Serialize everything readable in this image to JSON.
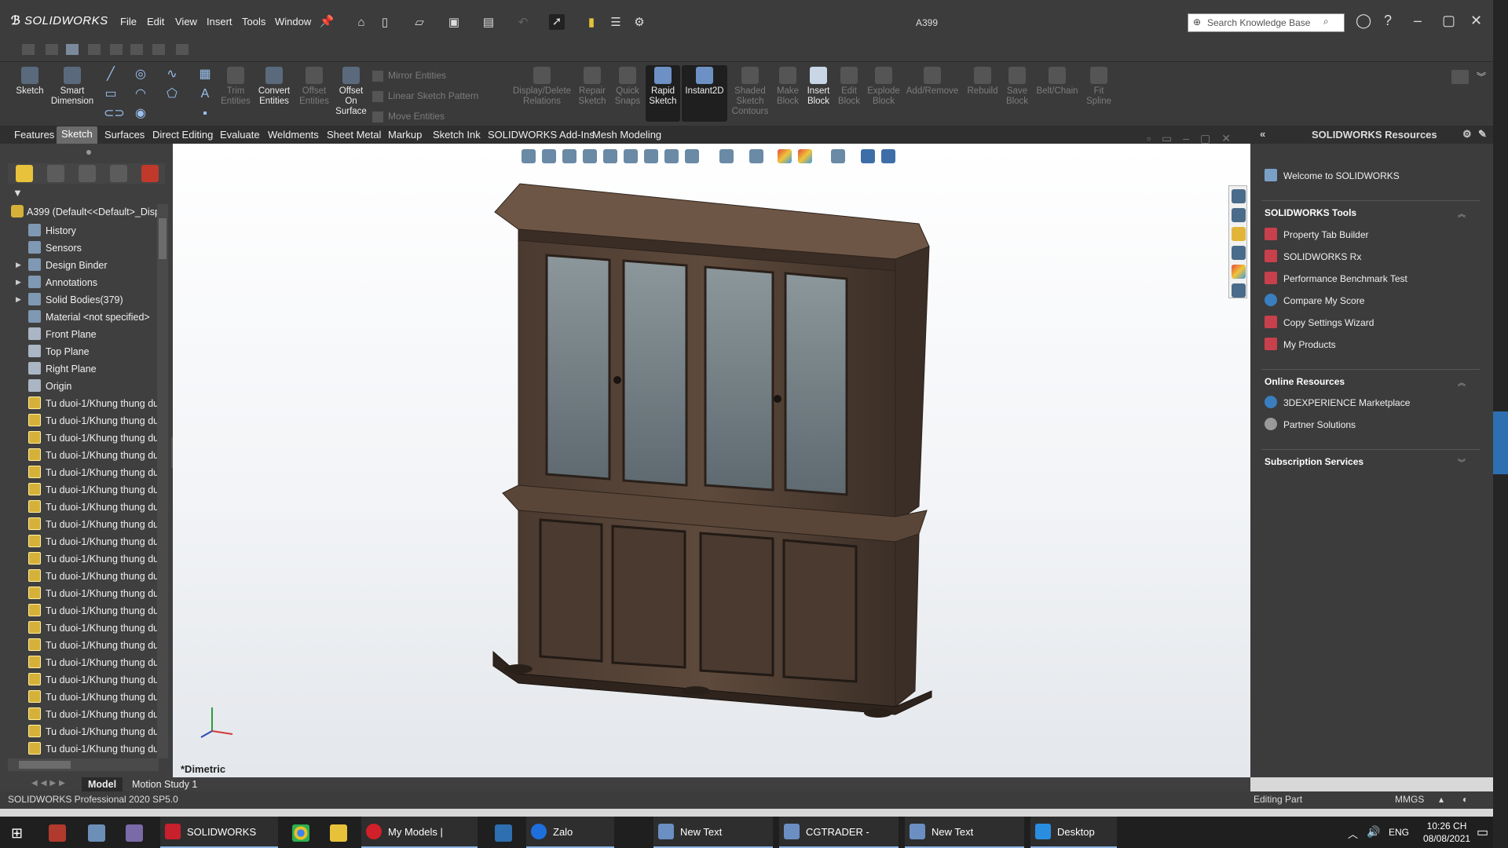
{
  "titlebar": {
    "brand": "SOLIDWORKS",
    "menus": [
      "File",
      "Edit",
      "View",
      "Insert",
      "Tools",
      "Window"
    ],
    "document_title": "A399",
    "search_placeholder": "Search Knowledge Base"
  },
  "command_manager": {
    "sketch": "Sketch",
    "smart_dimension": "Smart Dimension",
    "trim": "Trim Entities",
    "convert": "Convert Entities",
    "offset": "Offset Entities",
    "offset_surface": "Offset On Surface",
    "mirror": "Mirror Entities",
    "linear_pattern": "Linear Sketch Pattern",
    "move": "Move Entities",
    "display_delete": "Display/Delete Relations",
    "repair": "Repair Sketch",
    "quick_snaps": "Quick Snaps",
    "rapid_sketch": "Rapid Sketch",
    "instant2d": "Instant2D",
    "shaded": "Shaded Sketch Contours",
    "make_block": "Make Block",
    "insert_block": "Insert Block",
    "edit_block": "Edit Block",
    "explode_block": "Explode Block",
    "add_remove": "Add/Remove",
    "rebuild": "Rebuild",
    "save_block": "Save Block",
    "belt_chain": "Belt/Chain",
    "fit_spline": "Fit Spline"
  },
  "tabs": [
    "Features",
    "Sketch",
    "Surfaces",
    "Direct Editing",
    "Evaluate",
    "Weldments",
    "Sheet Metal",
    "Markup",
    "Sketch Ink",
    "SOLIDWORKS Add-Ins",
    "Mesh Modeling"
  ],
  "selected_tab": "Sketch",
  "tree": {
    "root": "A399  (Default<<Default>_Disp",
    "items": [
      {
        "label": "History",
        "icon": "history-icon"
      },
      {
        "label": "Sensors",
        "icon": "sensors-icon"
      },
      {
        "label": "Design Binder",
        "icon": "binder-icon"
      },
      {
        "label": "Annotations",
        "icon": "annotations-icon"
      },
      {
        "label": "Solid Bodies(379)",
        "icon": "solid-bodies-icon"
      },
      {
        "label": "Material <not specified>",
        "icon": "material-icon"
      },
      {
        "label": "Front Plane",
        "icon": "plane-icon"
      },
      {
        "label": "Top Plane",
        "icon": "plane-icon"
      },
      {
        "label": "Right Plane",
        "icon": "plane-icon"
      },
      {
        "label": "Origin",
        "icon": "origin-icon"
      }
    ],
    "part_item_label": "Tu duoi-1/Khung thung du",
    "part_item_count": 21
  },
  "viewport": {
    "view_name": "*Dimetric",
    "model": "wooden display cabinet (hutch) with glass doors"
  },
  "task_pane": {
    "title": "SOLIDWORKS Resources",
    "welcome": "Welcome to SOLIDWORKS",
    "tools_header": "SOLIDWORKS Tools",
    "tools": [
      "Property Tab Builder",
      "SOLIDWORKS Rx",
      "Performance Benchmark Test",
      "Compare My Score",
      "Copy Settings Wizard",
      "My Products"
    ],
    "online_header": "Online Resources",
    "online": [
      "3DEXPERIENCE Marketplace",
      "Partner Solutions"
    ],
    "subscription_header": "Subscription Services"
  },
  "bottom_tabs": [
    "Model",
    "Motion Study 1"
  ],
  "status": {
    "product": "SOLIDWORKS Professional 2020 SP5.0",
    "mode": "Editing Part",
    "units": "MMGS"
  },
  "taskbar": {
    "apps": [
      {
        "label": "SOLIDWORKS Profe...",
        "color": "#c8202c"
      },
      {
        "label": "My Models | CGTra...",
        "color": "#d0202a"
      },
      {
        "label": "Zalo",
        "color": "#1e6fdc"
      },
      {
        "label": "New Text Documen...",
        "color": "#6b8fc2"
      },
      {
        "label": "CGTRADER - Notep...",
        "color": "#6b8fc2"
      },
      {
        "label": "New Text Documen...",
        "color": "#6b8fc2"
      },
      {
        "label": "Desktop",
        "color": "#2a8ee0"
      }
    ],
    "lang": "ENG",
    "time": "10:26 CH",
    "date": "08/08/2021"
  }
}
